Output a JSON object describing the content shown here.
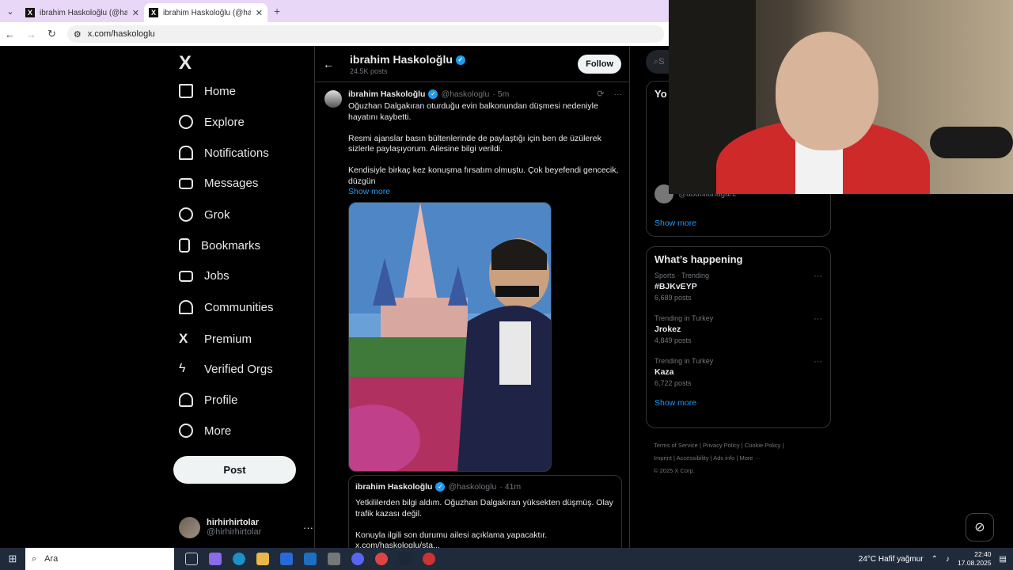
{
  "browser": {
    "tabs": [
      {
        "title": "ibrahim Haskoloğlu (@haskolo",
        "active": false
      },
      {
        "title": "ibrahim Haskoloğlu (@haskolo",
        "active": true
      }
    ],
    "new_tab": "+",
    "url": "x.com/haskologlu"
  },
  "nav": {
    "brand": "X",
    "items": [
      {
        "label": "Home",
        "icon": "home-icon"
      },
      {
        "label": "Explore",
        "icon": "search-icon"
      },
      {
        "label": "Notifications",
        "icon": "bell-icon"
      },
      {
        "label": "Messages",
        "icon": "mail-icon"
      },
      {
        "label": "Grok",
        "icon": "grok-icon"
      },
      {
        "label": "Bookmarks",
        "icon": "bookmark-icon"
      },
      {
        "label": "Jobs",
        "icon": "briefcase-icon"
      },
      {
        "label": "Communities",
        "icon": "people-icon"
      },
      {
        "label": "Premium",
        "icon": "x-icon"
      },
      {
        "label": "Verified Orgs",
        "icon": "lightning-icon"
      },
      {
        "label": "Profile",
        "icon": "person-icon"
      },
      {
        "label": "More",
        "icon": "more-circle-icon"
      }
    ],
    "post_label": "Post",
    "account": {
      "name": "hirhirhirtolar",
      "handle": "@hirhirhirtolar",
      "dots": "···"
    }
  },
  "profile_header": {
    "name": "ibrahim Haskoloğlu",
    "post_count": "24.5K posts",
    "follow_label": "Follow"
  },
  "tweet": {
    "name": "ibrahim Haskoloğlu",
    "handle": "@haskologlu",
    "time": "· 5m",
    "more": "···",
    "text": "Oğuzhan Dalgakıran oturduğu evin balkonundan düşmesi nedeniyle hayatını kaybetti.\n\nResmi ajanslar basın bültenlerinde de paylaştığı için ben de üzülerek sizlerle paylaşıyorum. Ailesine bilgi verildi.\n\nKendisiyle birkaç kez konuşma fırsatım olmuştu. Çok beyefendi gencecik, düzgün",
    "show_more": "Show more"
  },
  "quote": {
    "name": "ibrahim Haskoloğlu",
    "handle": "@haskologlu",
    "time": "· 41m",
    "text": "Yetkililerden bilgi aldım. Oğuzhan Dalgakıran yüksekten düşmüş. Olay trafik kazası değil.\n\nKonuyla ilgili son durumu ailesi açıklama yapacaktır.\nx.com/haskologlu/sta..."
  },
  "right": {
    "search_placeholder": "S",
    "who_to_follow_title_partial": "Yo",
    "wtf_handle": "@abdullahagar2",
    "wtf_show_more": "Show more",
    "happening_title": "What’s happening",
    "trends": [
      {
        "meta": "Sports · Trending",
        "title": "#BJKvEYP",
        "posts": "6,689 posts"
      },
      {
        "meta": "Trending in Turkey",
        "title": "Jrokez",
        "posts": "4,849 posts"
      },
      {
        "meta": "Trending in Turkey",
        "title": "Kaza",
        "posts": "6,722 posts"
      }
    ],
    "trend_dots": "···",
    "happening_show_more": "Show more",
    "footer": [
      "Terms of Service",
      "|",
      "Privacy Policy",
      "|",
      "Cookie Policy",
      "|",
      "Imprint",
      "|",
      "Accessibility",
      "|",
      "Ads info",
      "|",
      "More ···",
      "© 2025 X Corp."
    ]
  },
  "taskbar": {
    "search_label": "Ara",
    "weather": "24°C  Hafif yağmur",
    "time": "22:40",
    "date": "17.08.2025"
  },
  "colors": {
    "accent": "#1d9bf0",
    "bg": "#000000",
    "tabbar": "#e9d7f7"
  }
}
